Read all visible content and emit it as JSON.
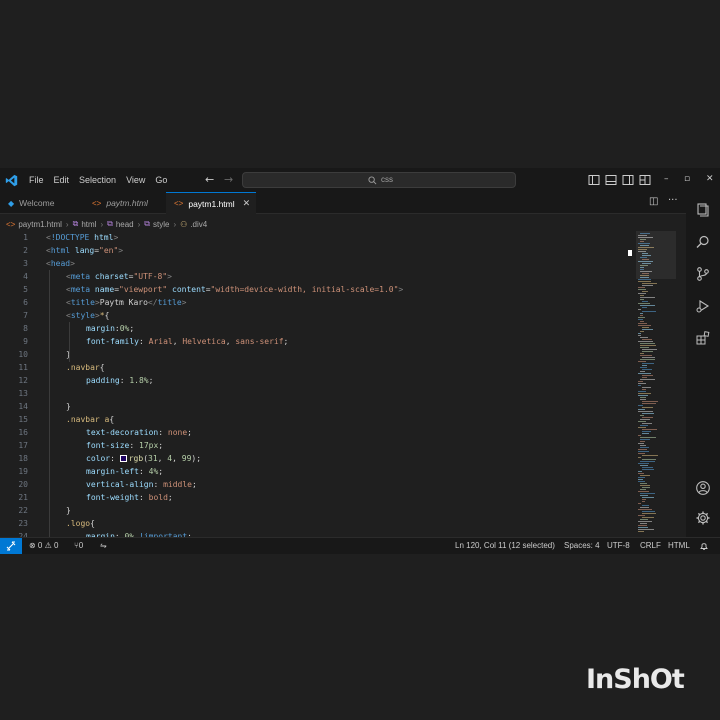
{
  "app": {
    "menu": [
      "File",
      "Edit",
      "Selection",
      "View",
      "Go"
    ],
    "search": "css",
    "window_controls": [
      "–",
      "▫",
      "✕"
    ]
  },
  "tabs": [
    {
      "label": "Welcome",
      "icon": "vscode-icon",
      "active": false
    },
    {
      "label": "paytm.html",
      "icon": "html-icon",
      "active": false
    },
    {
      "label": "paytm1.html",
      "icon": "html-icon",
      "active": true,
      "close": "✕"
    }
  ],
  "breadcrumb": [
    "paytm1.html",
    "html",
    "head",
    "style",
    ".div4"
  ],
  "editor": {
    "lines": [
      {
        "n": "1",
        "indent": 0,
        "parts": [
          [
            "t-punc",
            "<"
          ],
          [
            "t-tag",
            "!DOCTYPE"
          ],
          [
            "t-attr",
            " html"
          ],
          [
            "t-punc",
            ">"
          ]
        ]
      },
      {
        "n": "2",
        "indent": 0,
        "parts": [
          [
            "t-punc",
            "<"
          ],
          [
            "t-tag",
            "html"
          ],
          [
            "t-attr",
            " lang"
          ],
          [
            "t-text",
            "="
          ],
          [
            "t-str",
            "\"en\""
          ],
          [
            "t-punc",
            ">"
          ]
        ]
      },
      {
        "n": "3",
        "indent": 0,
        "parts": [
          [
            "t-punc",
            "<"
          ],
          [
            "t-tag",
            "head"
          ],
          [
            "t-punc",
            ">"
          ]
        ]
      },
      {
        "n": "4",
        "indent": 1,
        "parts": [
          [
            "t-punc",
            "<"
          ],
          [
            "t-tag",
            "meta"
          ],
          [
            "t-attr",
            " charset"
          ],
          [
            "t-text",
            "="
          ],
          [
            "t-str",
            "\"UTF-8\""
          ],
          [
            "t-punc",
            ">"
          ]
        ]
      },
      {
        "n": "5",
        "indent": 1,
        "parts": [
          [
            "t-punc",
            "<"
          ],
          [
            "t-tag",
            "meta"
          ],
          [
            "t-attr",
            " name"
          ],
          [
            "t-text",
            "="
          ],
          [
            "t-str",
            "\"viewport\""
          ],
          [
            "t-attr",
            " content"
          ],
          [
            "t-text",
            "="
          ],
          [
            "t-str",
            "\"width=device-width, initial-scale=1.0\""
          ],
          [
            "t-punc",
            ">"
          ]
        ]
      },
      {
        "n": "6",
        "indent": 1,
        "parts": [
          [
            "t-punc",
            "<"
          ],
          [
            "t-tag",
            "title"
          ],
          [
            "t-punc",
            ">"
          ],
          [
            "t-text",
            "Paytm Karo"
          ],
          [
            "t-punc",
            "</"
          ],
          [
            "t-tag",
            "title"
          ],
          [
            "t-punc",
            ">"
          ]
        ]
      },
      {
        "n": "7",
        "indent": 1,
        "parts": [
          [
            "t-punc",
            "<"
          ],
          [
            "t-tag",
            "style"
          ],
          [
            "t-punc",
            ">"
          ],
          [
            "t-sel",
            "*"
          ],
          [
            "t-text",
            "{"
          ]
        ]
      },
      {
        "n": "8",
        "indent": 2,
        "parts": [
          [
            "t-prop",
            "margin"
          ],
          [
            "t-text",
            ":"
          ],
          [
            "t-num",
            "0%"
          ],
          [
            "t-text",
            ";"
          ]
        ]
      },
      {
        "n": "9",
        "indent": 2,
        "parts": [
          [
            "t-prop",
            "font-family"
          ],
          [
            "t-text",
            ": "
          ],
          [
            "t-val",
            "Arial"
          ],
          [
            "t-text",
            ", "
          ],
          [
            "t-val",
            "Helvetica"
          ],
          [
            "t-text",
            ", "
          ],
          [
            "t-val",
            "sans-serif"
          ],
          [
            "t-text",
            ";"
          ]
        ]
      },
      {
        "n": "10",
        "indent": 1,
        "parts": [
          [
            "t-text",
            "}"
          ]
        ]
      },
      {
        "n": "11",
        "indent": 1,
        "parts": [
          [
            "t-sel",
            ".navbar"
          ],
          [
            "t-text",
            "{"
          ]
        ]
      },
      {
        "n": "12",
        "indent": 2,
        "parts": [
          [
            "t-prop",
            "padding"
          ],
          [
            "t-text",
            ": "
          ],
          [
            "t-num",
            "1.8%"
          ],
          [
            "t-text",
            ";"
          ]
        ]
      },
      {
        "n": "13",
        "indent": 0,
        "parts": []
      },
      {
        "n": "14",
        "indent": 1,
        "parts": [
          [
            "t-text",
            "}"
          ]
        ]
      },
      {
        "n": "15",
        "indent": 1,
        "parts": [
          [
            "t-sel",
            ".navbar a"
          ],
          [
            "t-text",
            "{"
          ]
        ]
      },
      {
        "n": "16",
        "indent": 2,
        "parts": [
          [
            "t-prop",
            "text-decoration"
          ],
          [
            "t-text",
            ": "
          ],
          [
            "t-val",
            "none"
          ],
          [
            "t-text",
            ";"
          ]
        ]
      },
      {
        "n": "17",
        "indent": 2,
        "parts": [
          [
            "t-prop",
            "font-size"
          ],
          [
            "t-text",
            ": "
          ],
          [
            "t-num",
            "17px"
          ],
          [
            "t-text",
            ";"
          ]
        ]
      },
      {
        "n": "18",
        "indent": 2,
        "parts": [
          [
            "t-prop",
            "color"
          ],
          [
            "t-text",
            ": "
          ],
          [
            "swatch",
            ""
          ],
          [
            "t-fn",
            "rgb"
          ],
          [
            "t-text",
            "("
          ],
          [
            "t-num",
            "31"
          ],
          [
            "t-text",
            ", "
          ],
          [
            "t-num",
            "4"
          ],
          [
            "t-text",
            ", "
          ],
          [
            "t-num",
            "99"
          ],
          [
            "t-text",
            ");"
          ]
        ]
      },
      {
        "n": "19",
        "indent": 2,
        "parts": [
          [
            "t-prop",
            "margin-left"
          ],
          [
            "t-text",
            ": "
          ],
          [
            "t-num",
            "4%"
          ],
          [
            "t-text",
            ";"
          ]
        ]
      },
      {
        "n": "20",
        "indent": 2,
        "parts": [
          [
            "t-prop",
            "vertical-align"
          ],
          [
            "t-text",
            ": "
          ],
          [
            "t-val",
            "middle"
          ],
          [
            "t-text",
            ";"
          ]
        ]
      },
      {
        "n": "21",
        "indent": 2,
        "parts": [
          [
            "t-prop",
            "font-weight"
          ],
          [
            "t-text",
            ": "
          ],
          [
            "t-val",
            "bold"
          ],
          [
            "t-text",
            ";"
          ]
        ]
      },
      {
        "n": "22",
        "indent": 1,
        "parts": [
          [
            "t-text",
            "}"
          ]
        ]
      },
      {
        "n": "23",
        "indent": 1,
        "parts": [
          [
            "t-sel",
            ".logo"
          ],
          [
            "t-text",
            "{"
          ]
        ]
      },
      {
        "n": "24",
        "indent": 2,
        "parts": [
          [
            "t-prop",
            "margin"
          ],
          [
            "t-text",
            ": "
          ],
          [
            "t-num",
            "0%"
          ],
          [
            "t-kw",
            " !important"
          ],
          [
            "t-text",
            ";"
          ]
        ]
      }
    ]
  },
  "statusbar": {
    "problems": "⊗ 0 ⚠ 0",
    "ports": "⑂0",
    "cursor": "Ln 120, Col 11 (12 selected)",
    "spaces": "Spaces: 4",
    "encoding": "UTF-8",
    "eol": "CRLF",
    "language": "HTML"
  },
  "watermark": "InShOt",
  "colors": {
    "accent": "#0078d4",
    "background": "#1f1f1f",
    "chrome": "#181818"
  }
}
